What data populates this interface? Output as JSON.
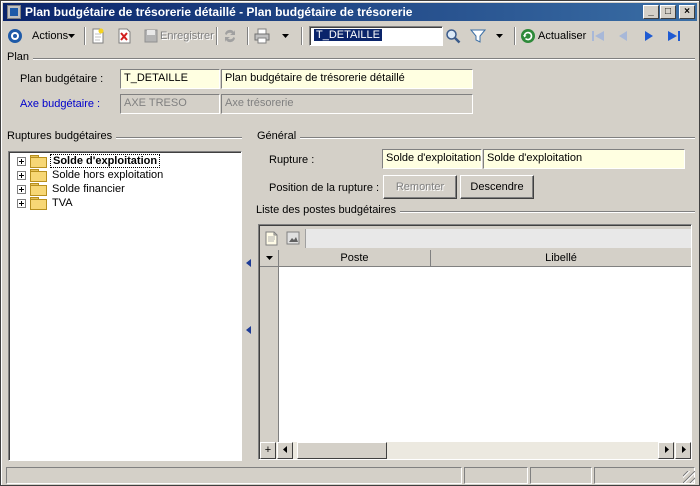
{
  "window": {
    "title": "Plan budgétaire de trésorerie détaillé -  Plan budgétaire de trésorerie",
    "buttons": [
      "_",
      "□",
      "×"
    ]
  },
  "toolbar": {
    "actions_label": "Actions",
    "save_label": "Enregistrer",
    "code_value": "T_DETAILLE",
    "refresh_label": "Actualiser"
  },
  "plan": {
    "section_title": "Plan",
    "plan_label": "Plan budgétaire :",
    "plan_code": "T_DETAILLE",
    "plan_name": "Plan budgétaire de trésorerie détaillé",
    "axe_label": "Axe budgétaire :",
    "axe_code": "AXE TRESO",
    "axe_name": "Axe trésorerie"
  },
  "ruptures": {
    "section_title": "Ruptures budgétaires",
    "items": [
      {
        "label": "Solde d'exploitation",
        "selected": true
      },
      {
        "label": "Solde hors exploitation",
        "selected": false
      },
      {
        "label": "Solde financier",
        "selected": false
      },
      {
        "label": "TVA",
        "selected": false
      }
    ]
  },
  "general": {
    "section_title": "Général",
    "rupture_label": "Rupture :",
    "rupture_code": "Solde d'exploitation",
    "rupture_name": "Solde d'exploitation",
    "position_label": "Position de la rupture :",
    "up_button": "Remonter",
    "down_button": "Descendre"
  },
  "postes": {
    "section_title": "Liste des postes budgétaires",
    "columns": [
      "Poste",
      "Libellé"
    ],
    "rows": [],
    "add_symbol": "+"
  },
  "colors": {
    "title_start": "#0a246a",
    "title_end": "#3a6ea5",
    "field_yellow": "#ffffe1",
    "link_blue": "#0000cc"
  }
}
